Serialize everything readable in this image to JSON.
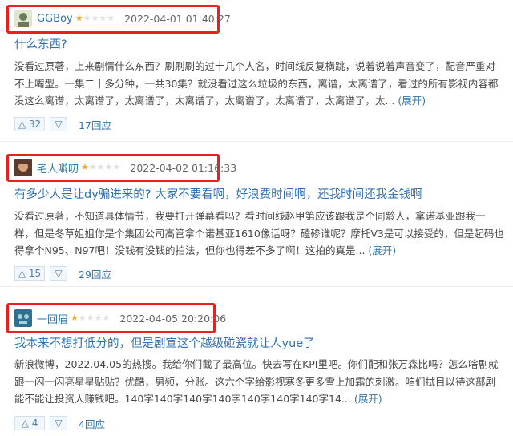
{
  "reviews": [
    {
      "username": "GGBoy",
      "rating": 1,
      "date": "2022-04-01 01:40:27",
      "title": "什么东西?",
      "body": "没看过原著，上来剧情什么东西？刷刷刷的过十几个人名，时间线反复横跳，说着说着声音变了，配音严重对不上嘴型。一集二十多分钟，一共30集？就没看过这么垃圾的东西，离谱，太离谱了，看过的所有影视内容都没这么离谱，太离谱了，太离谱了，太离谱了，太离谱了，太离谱了，太离谱了，太...",
      "expand_label": "(展开)",
      "upvotes": "32",
      "replies": "17回应",
      "avatar_colors": [
        "#dfe6cf",
        "#6e7b5a"
      ]
    },
    {
      "username": "宅人噼叨",
      "rating": 1,
      "date": "2022-04-02 01:16:33",
      "title": "有多少人是让dy骗进来的? 大家不要看啊，好浪费时间啊，还我时间还我金钱啊",
      "body": "没看过原著，不知道具体情节，我要打开弹幕看吗？看时间线赵甲第应该跟我是个同龄人，拿诺基亚跟我一样，但是冬草姐姐你是个集团公司高管拿个诺基亚1610像话呀？磕碜谁呢？摩托V3是可以接受的，但是起码也得拿个N95、N97吧！没钱有没钱的拍法，但你也得差不多了啊！这拍的真是...",
      "expand_label": "(展开)",
      "upvotes": "15",
      "replies": "29回应",
      "avatar_colors": [
        "#5a3b2e",
        "#d9a37e"
      ]
    },
    {
      "username": "一回眉",
      "rating": 1,
      "date": "2022-04-05 20:20:06",
      "title": "我本来不想打低分的，但是剧宣这个越级碰瓷就让人yue了",
      "body": "新浪微博，2022.04.05的热搜。我给你们截了最高位。快去写在KPI里吧。你们配和张万森比吗？怎么啥剧就跟一闪一闪亮星星贴贴？优酷，男频，分账。这六个字给影视寒冬更多雪上加霜的刺激。咱们拭目以待这部剧能不能让投资人赚钱吧。140字140字140字140字140字140字140字14...",
      "expand_label": "(展开)",
      "upvotes": "4",
      "replies": "4回应",
      "avatar_colors": [
        "#2f6f8f",
        "#a8d0dc"
      ]
    }
  ],
  "icons": {
    "upvote": "triangle-up-icon",
    "downvote": "triangle-down-icon",
    "star": "star-icon"
  }
}
